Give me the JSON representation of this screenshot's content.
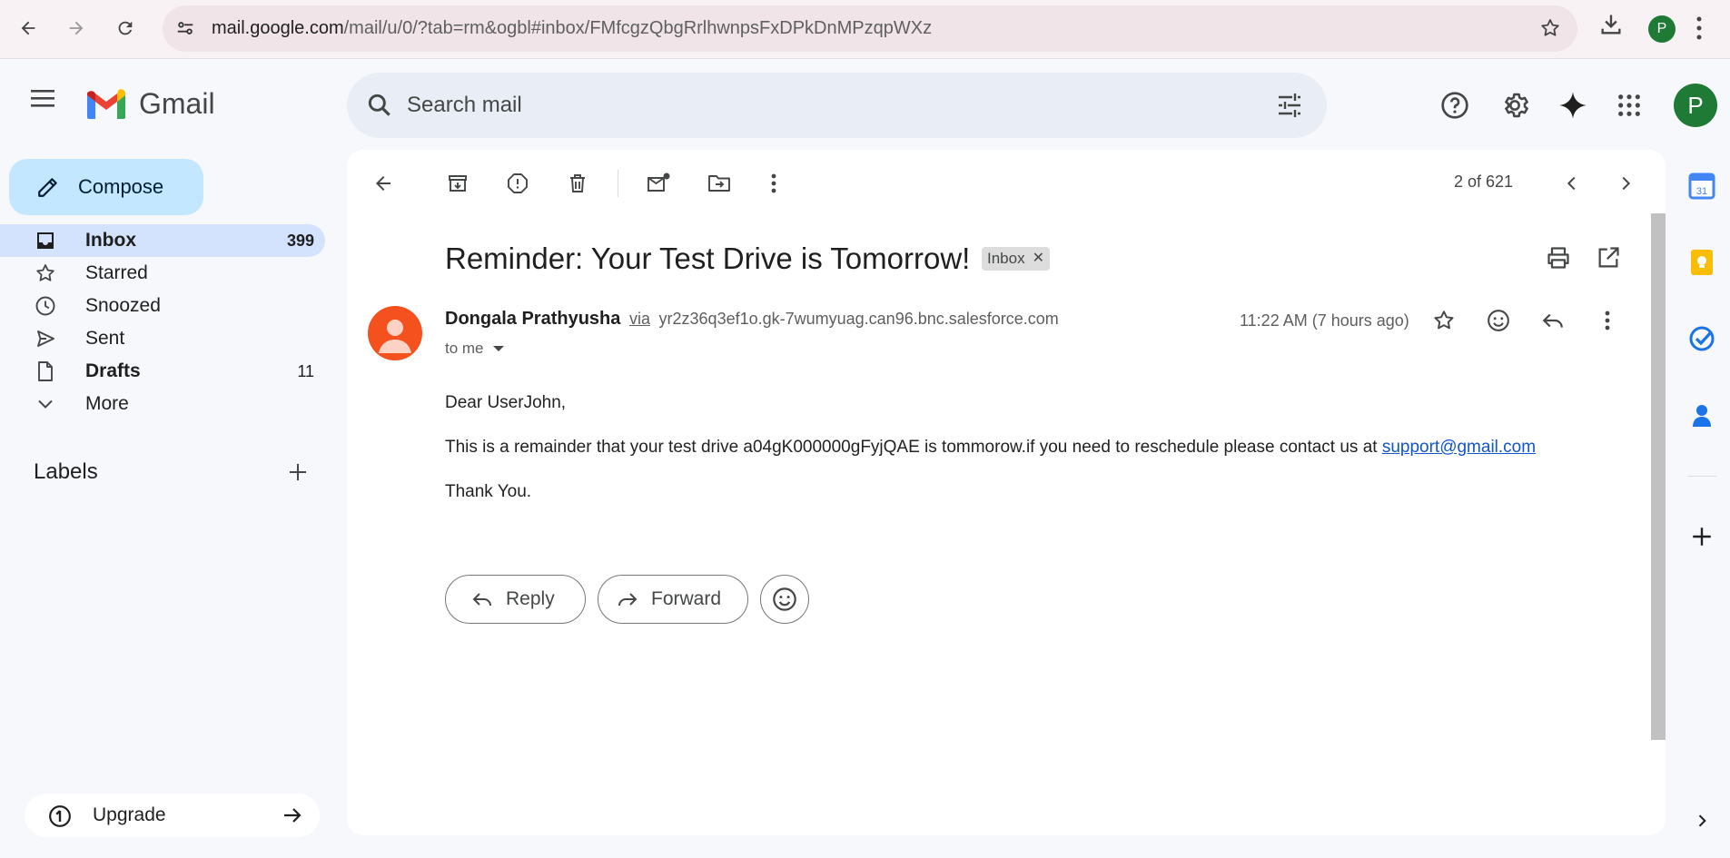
{
  "browser": {
    "url_host": "mail.google.com",
    "url_path": "/mail/u/0/?tab=rm&ogbl#inbox/FMfcgzQbgRrlhwnpsFxDPkDnMPzqpWXz",
    "profile_initial": "P"
  },
  "header": {
    "app_name": "Gmail",
    "search_placeholder": "Search mail",
    "account_initial": "P"
  },
  "sidebar": {
    "compose_label": "Compose",
    "items": [
      {
        "label": "Inbox",
        "count": "399",
        "icon": "inbox-icon",
        "bold": true,
        "active": true
      },
      {
        "label": "Starred",
        "count": "",
        "icon": "star-icon",
        "bold": false,
        "active": false
      },
      {
        "label": "Snoozed",
        "count": "",
        "icon": "clock-icon",
        "bold": false,
        "active": false
      },
      {
        "label": "Sent",
        "count": "",
        "icon": "send-icon",
        "bold": false,
        "active": false
      },
      {
        "label": "Drafts",
        "count": "11",
        "icon": "draft-icon",
        "bold": true,
        "active": false
      },
      {
        "label": "More",
        "count": "",
        "icon": "chevron-down-icon",
        "bold": false,
        "active": false
      }
    ],
    "labels_heading": "Labels",
    "upgrade_label": "Upgrade"
  },
  "toolbar": {
    "pager": "2 of 621"
  },
  "email": {
    "subject": "Reminder: Your Test Drive is Tomorrow!",
    "label_chip": "Inbox",
    "sender_name": "Dongala Prathyusha",
    "via": "via",
    "sender_address": "yr2z36q3ef1o.gk-7wumyuag.can96.bnc.salesforce.com",
    "to": "to me",
    "time": "11:22 AM (7 hours ago)",
    "greeting": "Dear UserJohn,",
    "body_line": "This is a remainder that your test drive a04gK000000gFyjQAE is tommorow.if you need to reschedule please contact us at ",
    "body_link": "support@gmail.com",
    "closing": "Thank You.",
    "reply_label": "Reply",
    "forward_label": "Forward"
  },
  "colors": {
    "accent": "#0b57d0",
    "compose_bg": "#c2e7ff",
    "active_nav": "#d3e3fd",
    "avatar_green": "#1e7a34",
    "sender_avatar": "#f4511e"
  }
}
